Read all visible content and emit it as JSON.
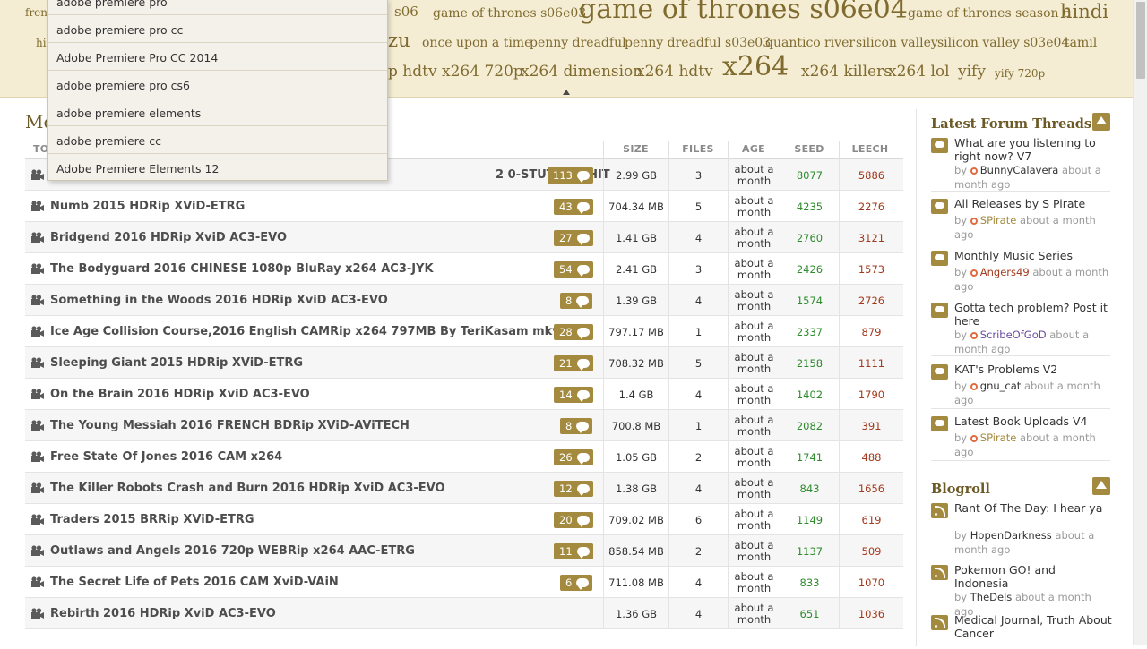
{
  "tag_cloud": {
    "tags": [
      {
        "text": "french",
        "size": 12
      },
      {
        "text": "s06",
        "size": 15
      },
      {
        "text": "game of thrones s06e03",
        "size": 14
      },
      {
        "text": "game of thrones s06e04",
        "size": 30
      },
      {
        "text": "game of thrones season 6",
        "size": 14
      },
      {
        "text": "hindi",
        "size": 21
      },
      {
        "text": "hi",
        "size": 12
      },
      {
        "text": "zu",
        "size": 21
      },
      {
        "text": "once upon a time",
        "size": 14
      },
      {
        "text": "penny dreadful",
        "size": 14
      },
      {
        "text": "penny dreadful s03e03",
        "size": 14
      },
      {
        "text": "quantico",
        "size": 14
      },
      {
        "text": "river",
        "size": 14
      },
      {
        "text": "silicon valley",
        "size": 14
      },
      {
        "text": "silicon valley s03e04",
        "size": 14
      },
      {
        "text": "tamil",
        "size": 14
      },
      {
        "text": "p hdtv",
        "size": 17
      },
      {
        "text": "x264 720p",
        "size": 17
      },
      {
        "text": "x264 dimension",
        "size": 17
      },
      {
        "text": "x264 hdtv",
        "size": 17
      },
      {
        "text": "x264",
        "size": 30
      },
      {
        "text": "x264 killers",
        "size": 17
      },
      {
        "text": "x264 lol",
        "size": 17
      },
      {
        "text": "yify",
        "size": 17
      },
      {
        "text": "yify 720p",
        "size": 12
      }
    ]
  },
  "autocomplete": {
    "items": [
      "adobe premiere pro",
      "adobe premiere pro cc",
      "Adobe Premiere Pro CC 2014",
      "adobe premiere pro cs6",
      "adobe premiere elements",
      "adobe premiere cc",
      "Adobe Premiere Elements 12"
    ]
  },
  "main": {
    "title_partial": "Mo",
    "table": {
      "headers": {
        "name": "TO",
        "size": "SIZE",
        "files": "FILES",
        "age": "AGE",
        "seed": "SEED",
        "leech": "LEECH"
      },
      "rows": [
        {
          "name": "2 0-STUTTERSHIT",
          "comments": "113",
          "size": "2.99 GB",
          "files": "3",
          "age": [
            "about a",
            "month"
          ],
          "seed": "8077",
          "leech": "5886"
        },
        {
          "name": "Numb 2015 HDRip XViD-ETRG",
          "comments": "43",
          "size": "704.34 MB",
          "files": "5",
          "age": [
            "about a",
            "month"
          ],
          "seed": "4235",
          "leech": "2276"
        },
        {
          "name": "Bridgend 2016 HDRip XviD AC3-EVO",
          "comments": "27",
          "size": "1.41 GB",
          "files": "4",
          "age": [
            "about a",
            "month"
          ],
          "seed": "2760",
          "leech": "3121"
        },
        {
          "name": "The Bodyguard 2016 CHINESE 1080p BluRay x264 AC3-JYK",
          "comments": "54",
          "size": "2.41 GB",
          "files": "3",
          "age": [
            "about a",
            "month"
          ],
          "seed": "2426",
          "leech": "1573"
        },
        {
          "name": "Something in the Woods 2016 HDRip XviD AC3-EVO",
          "comments": "8",
          "size": "1.39 GB",
          "files": "4",
          "age": [
            "about a",
            "month"
          ],
          "seed": "1574",
          "leech": "2726"
        },
        {
          "name": "Ice Age Collision Course,2016 English CAMRip x264 797MB By TeriKasam mkv",
          "comments": "28",
          "size": "797.17 MB",
          "files": "1",
          "age": [
            "about a",
            "month"
          ],
          "seed": "2337",
          "leech": "879"
        },
        {
          "name": "Sleeping Giant 2015 HDRip XViD-ETRG",
          "comments": "21",
          "size": "708.32 MB",
          "files": "5",
          "age": [
            "about a",
            "month"
          ],
          "seed": "2158",
          "leech": "1111"
        },
        {
          "name": "On the Brain 2016 HDRip XviD AC3-EVO",
          "comments": "14",
          "size": "1.4 GB",
          "files": "4",
          "age": [
            "about a",
            "month"
          ],
          "seed": "1402",
          "leech": "1790"
        },
        {
          "name": "The Young Messiah 2016 FRENCH BDRip XViD-AViTECH",
          "comments": "8",
          "size": "700.8 MB",
          "files": "1",
          "age": [
            "about a",
            "month"
          ],
          "seed": "2082",
          "leech": "391"
        },
        {
          "name": "Free State Of Jones 2016 CAM x264",
          "comments": "26",
          "size": "1.05 GB",
          "files": "2",
          "age": [
            "about a",
            "month"
          ],
          "seed": "1741",
          "leech": "488"
        },
        {
          "name": "The Killer Robots Crash and Burn 2016 HDRip XviD AC3-EVO",
          "comments": "12",
          "size": "1.38 GB",
          "files": "4",
          "age": [
            "about a",
            "month"
          ],
          "seed": "843",
          "leech": "1656"
        },
        {
          "name": "Traders 2015 BRRip XViD-ETRG",
          "comments": "20",
          "size": "709.02 MB",
          "files": "6",
          "age": [
            "about a",
            "month"
          ],
          "seed": "1149",
          "leech": "619"
        },
        {
          "name": "Outlaws and Angels 2016 720p WEBRip x264 AAC-ETRG",
          "comments": "11",
          "size": "858.54 MB",
          "files": "2",
          "age": [
            "about a",
            "month"
          ],
          "seed": "1137",
          "leech": "509"
        },
        {
          "name": "The Secret Life of Pets 2016 CAM XviD-VAiN",
          "comments": "6",
          "size": "711.08 MB",
          "files": "4",
          "age": [
            "about a",
            "month"
          ],
          "seed": "833",
          "leech": "1070"
        },
        {
          "name": "Rebirth 2016 HDRip XviD AC3-EVO",
          "comments": "",
          "size": "1.36 GB",
          "files": "4",
          "age": [
            "about a",
            "month"
          ],
          "seed": "651",
          "leech": "1036"
        }
      ]
    }
  },
  "sidebar": {
    "forum_title": "Latest Forum Threads",
    "threads": [
      {
        "title": "What are you listening to right now? V7",
        "by": "by",
        "user": "BunnyCalavera",
        "ago": "about a month ago"
      },
      {
        "title": "All Releases by S Pirate",
        "by": "by",
        "user": "SPirate",
        "ago": "about a month ago"
      },
      {
        "title": "Monthly Music Series",
        "by": "by",
        "user": "Angers49",
        "ago": "about a month ago"
      },
      {
        "title": "Gotta tech problem? Post it here",
        "by": "by",
        "user": "ScribeOfGoD",
        "ago": "about a month ago"
      },
      {
        "title": "KAT's Problems V2",
        "by": "by",
        "user": "gnu_cat",
        "ago": "about a month ago"
      },
      {
        "title": "Latest Book Uploads V4",
        "by": "by",
        "user": "SPirate",
        "ago": "about a month ago"
      }
    ],
    "blogroll_title": "Blogroll",
    "blogs": [
      {
        "title": "Rant Of The Day: I hear ya",
        "by": "by",
        "user": "HopenDarkness",
        "ago": "about a month ago"
      },
      {
        "title": "Pokemon GO! and Indonesia",
        "by": "by",
        "user": "TheDels",
        "ago": "about a month ago"
      },
      {
        "title": "Medical Journal, Truth About Cancer",
        "by": "",
        "user": "",
        "ago": ""
      }
    ]
  },
  "colors": {
    "accent": "#a38a3e",
    "tag": "#806b2f",
    "seed": "#2e8b2e",
    "leech": "#a23a1e",
    "header_bg": "#f4edd4"
  }
}
